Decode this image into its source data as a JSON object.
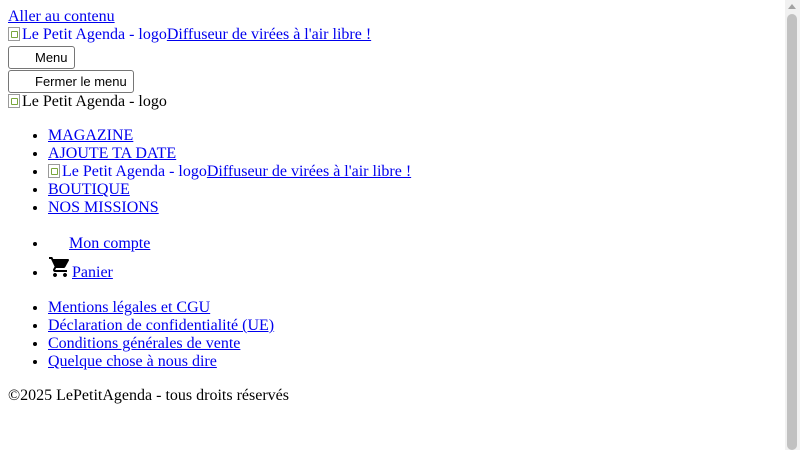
{
  "skip_link": "Aller au contenu",
  "header": {
    "logo_alt": "Le Petit Agenda - logo",
    "tagline": "Diffuseur de virées à l'air libre !"
  },
  "buttons": {
    "menu_label": "Menu",
    "close_menu_label": "Fermer le menu"
  },
  "menu_logo_alt": "Le Petit Agenda - logo",
  "nav": {
    "items": [
      {
        "label": "MAGAZINE"
      },
      {
        "label": "AJOUTE TA DATE"
      },
      {
        "logo_alt": "Le Petit Agenda - logo",
        "tagline": "Diffuseur de virées à l'air libre !"
      },
      {
        "label": "BOUTIQUE"
      },
      {
        "label": "NOS MISSIONS"
      }
    ]
  },
  "account": {
    "my_account": "Mon compte",
    "cart": "Panier",
    "cart_icon": "shopping-cart-icon"
  },
  "legal": {
    "items": [
      {
        "label": "Mentions légales et CGU"
      },
      {
        "label": "Déclaration de confidentialité (UE)"
      },
      {
        "label": "Conditions générales de vente"
      },
      {
        "label": "Quelque chose à nous dire"
      }
    ]
  },
  "copyright": "©2025 LePetitAgenda - tous droits réservés",
  "colors": {
    "link": "#0000ee",
    "text": "#000000"
  }
}
